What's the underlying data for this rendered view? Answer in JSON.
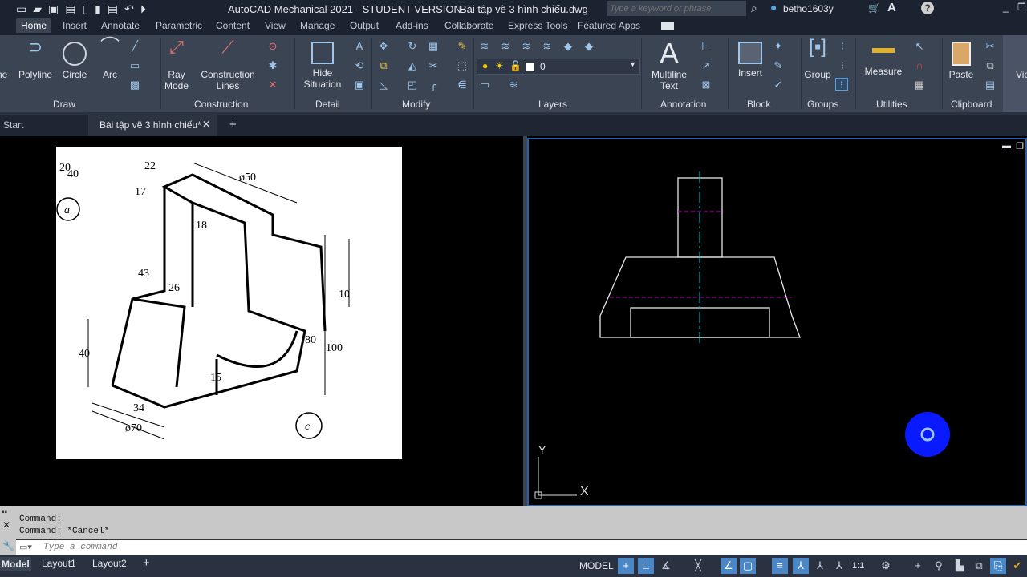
{
  "title": {
    "app": "AutoCAD Mechanical 2021 - STUDENT VERSION",
    "file": "Bài tập vẽ 3 hình chiếu.dwg",
    "search_placeholder": "Type a keyword or phrase",
    "user": "betho1603y"
  },
  "tabs": [
    "Home",
    "Insert",
    "Annotate",
    "Parametric",
    "Content",
    "View",
    "Manage",
    "Output",
    "Add-ins",
    "Collaborate",
    "Express Tools",
    "Featured Apps"
  ],
  "ribbon": {
    "draw": {
      "label": "Draw",
      "line": "ne",
      "polyline": "Polyline",
      "circle": "Circle",
      "arc": "Arc"
    },
    "construction": {
      "label": "Construction",
      "ray": "Ray Mode",
      "lines": "Construction Lines"
    },
    "detail": {
      "label": "Detail",
      "hide": "Hide Situation"
    },
    "modify": {
      "label": "Modify"
    },
    "layers": {
      "label": "Layers",
      "current": "0"
    },
    "annotation": {
      "label": "Annotation",
      "mtext": "Multiline Text"
    },
    "block": {
      "label": "Block",
      "insert": "Insert"
    },
    "groups": {
      "label": "Groups",
      "group": "Group"
    },
    "utilities": {
      "label": "Utilities",
      "measure": "Measure"
    },
    "clipboard": {
      "label": "Clipboard",
      "paste": "Paste"
    },
    "view": {
      "label": "Vie"
    }
  },
  "filetabs": {
    "start": "Start",
    "doc": "Bài tập vẽ 3 hình chiếu*"
  },
  "reference": {
    "dims": [
      "20",
      "40",
      "22",
      "ø50",
      "17",
      "18",
      "43",
      "26",
      "10",
      "80",
      "100",
      "40",
      "15",
      "34",
      "ø70"
    ],
    "labels": [
      "a",
      "c"
    ]
  },
  "ucs": {
    "x": "X",
    "y": "Y"
  },
  "colors": {
    "center": "#00c8c8",
    "hidden": "#c000c0",
    "accent": "#2c5fa8",
    "cursor": "#0a1aff"
  },
  "command": {
    "history": [
      "Command:",
      "Command: *Cancel*"
    ],
    "placeholder": "Type a command"
  },
  "layouts": [
    "Model",
    "Layout1",
    "Layout2"
  ],
  "status": {
    "model": "MODEL",
    "scale": "1:1"
  }
}
